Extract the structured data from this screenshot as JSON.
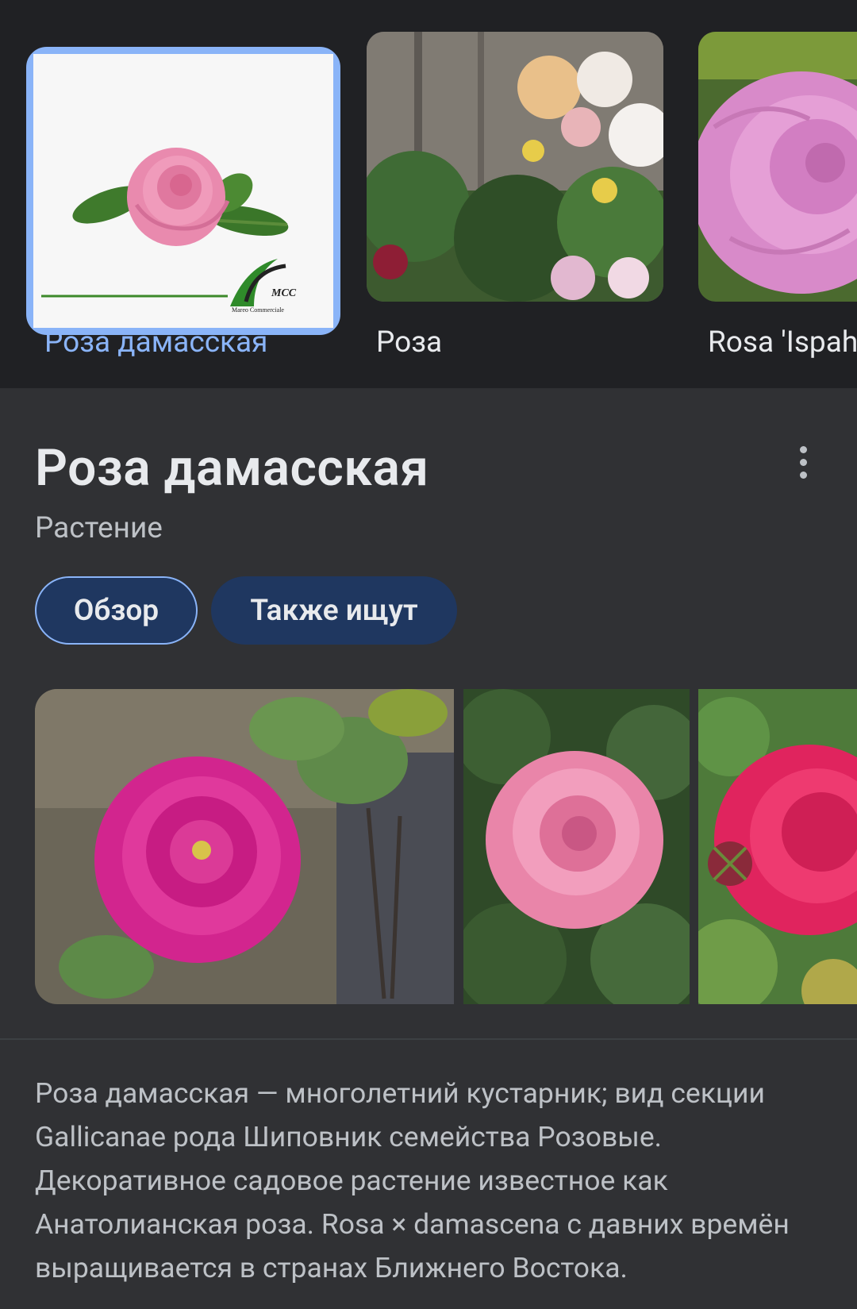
{
  "top_carousel": {
    "items": [
      {
        "label": "Роза дамасская",
        "selected": true,
        "logo_text": "MCC",
        "logo_subtext": "Mareo Commerciale"
      },
      {
        "label": "Роза",
        "selected": false
      },
      {
        "label": "Rosa 'Ispah",
        "selected": false
      }
    ]
  },
  "entity": {
    "title": "Роза дамасская",
    "subtitle": "Растение",
    "more_icon": "more-vert-icon"
  },
  "chips": [
    {
      "label": "Обзор",
      "active": true
    },
    {
      "label": "Также ищут",
      "active": false
    }
  ],
  "description": {
    "text": "Роза дамасская — многолетний кустарник; вид секции Gallicanae рода Шиповник семейства Розовые. Декоративное садовое растение известное как Анатолианская роза. Rosa × damascena с давних времён выращивается в странах Ближнего Востока."
  },
  "colors": {
    "accent": "#8ab4f8",
    "chip_bg": "#1f3760",
    "panel_bg": "#303134",
    "top_bg": "#202124"
  }
}
